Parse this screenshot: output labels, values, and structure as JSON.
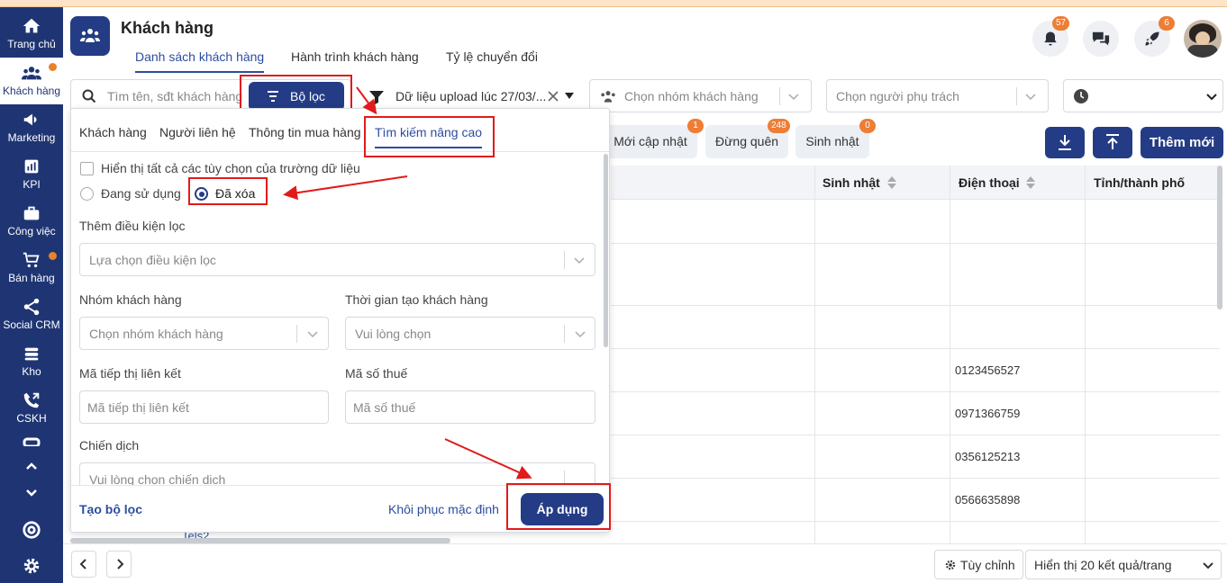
{
  "sidebar": {
    "items": [
      {
        "label": "Trang chủ",
        "icon": "home-icon"
      },
      {
        "label": "Khách hàng",
        "icon": "users-icon"
      },
      {
        "label": "Marketing",
        "icon": "megaphone-icon"
      },
      {
        "label": "KPI",
        "icon": "chart-icon"
      },
      {
        "label": "Công việc",
        "icon": "briefcase-icon"
      },
      {
        "label": "Bán hàng",
        "icon": "cart-icon"
      },
      {
        "label": "Social CRM",
        "icon": "share-icon"
      },
      {
        "label": "Kho",
        "icon": "warehouse-icon"
      },
      {
        "label": "CSKH",
        "icon": "phone-icon"
      }
    ]
  },
  "header": {
    "title": "Khách hàng",
    "tabs": [
      "Danh sách khách hàng",
      "Hành trình khách hàng",
      "Tỷ lệ chuyển đổi"
    ],
    "notifications_count": "57",
    "rocket_count": "6"
  },
  "toolbar": {
    "search_placeholder": "Tìm tên, sđt khách hàng",
    "filter_button": "Bộ lọc",
    "upload_filter": "Dữ liệu upload lúc 27/03/...",
    "group_placeholder": "Chọn nhóm khách hàng",
    "owner_placeholder": "Chọn người phụ trách"
  },
  "quick_filters": [
    {
      "label": "Mới cập nhật",
      "count": "1"
    },
    {
      "label": "Đừng quên",
      "count": "248"
    },
    {
      "label": "Sinh nhật",
      "count": "0"
    }
  ],
  "actions": {
    "add_new": "Thêm mới"
  },
  "table": {
    "headers": [
      "Sinh nhật",
      "Điện thoại",
      "Tỉnh/thành phố"
    ],
    "phones": [
      "",
      "",
      "",
      "0123456527",
      "0971366759",
      "0356125213",
      "0566635898"
    ],
    "partial_row_text": "Tels2"
  },
  "filter_panel": {
    "tabs": [
      "Khách hàng",
      "Người liên hệ",
      "Thông tin mua hàng",
      "Tìm kiếm nâng cao"
    ],
    "show_all_label": "Hiển thị tất cả các tùy chọn của trường dữ liệu",
    "radio_in_use": "Đang sử dụng",
    "radio_deleted": "Đã xóa",
    "add_condition_label": "Thêm điều kiện lọc",
    "add_condition_placeholder": "Lựa chọn điều kiện lọc",
    "group_label": "Nhóm khách hàng",
    "group_placeholder": "Chọn nhóm khách hàng",
    "created_label": "Thời gian tạo khách hàng",
    "created_placeholder": "Vui lòng chọn",
    "affiliate_label": "Mã tiếp thị liên kết",
    "affiliate_placeholder": "Mã tiếp thị liên kết",
    "tax_label": "Mã số thuế",
    "tax_placeholder": "Mã số thuế",
    "campaign_label": "Chiến dịch",
    "campaign_placeholder": "Vui lòng chọn chiến dịch",
    "create_filter": "Tạo bộ lọc",
    "reset": "Khôi phục mặc định",
    "apply": "Áp dụng"
  },
  "footer": {
    "customize": "Tùy chỉnh",
    "page_size": "Hiển thị 20 kết quả/trang"
  },
  "colors": {
    "primary": "#243c85",
    "accent": "#ee7d35",
    "annotation": "#e11b1b"
  }
}
